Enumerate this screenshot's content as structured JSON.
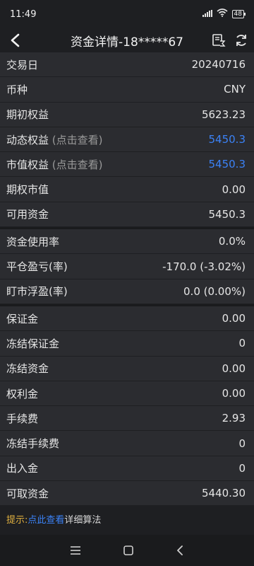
{
  "status": {
    "time": "11:49",
    "battery": "48"
  },
  "header": {
    "title": "资金详情-18*****67"
  },
  "section1": [
    {
      "label": "交易日",
      "hint": "",
      "value": "20240716",
      "link": false
    },
    {
      "label": "币种",
      "hint": "",
      "value": "CNY",
      "link": false
    },
    {
      "label": "期初权益",
      "hint": "",
      "value": "5623.23",
      "link": false
    },
    {
      "label": "动态权益",
      "hint": "(点击查看)",
      "value": "5450.3",
      "link": true
    },
    {
      "label": "市值权益",
      "hint": "(点击查看)",
      "value": "5450.3",
      "link": true
    },
    {
      "label": "期权市值",
      "hint": "",
      "value": "0.00",
      "link": false
    },
    {
      "label": "可用资金",
      "hint": "",
      "value": "5450.3",
      "link": false
    }
  ],
  "section2": [
    {
      "label": "资金使用率",
      "value": "0.0%"
    },
    {
      "label": "平仓盈亏(率)",
      "value": "-170.0 (-3.02%)"
    },
    {
      "label": "盯市浮盈(率)",
      "value": "0.0 (0.00%)"
    }
  ],
  "section3": [
    {
      "label": "保证金",
      "value": "0.00"
    },
    {
      "label": "冻结保证金",
      "value": "0"
    },
    {
      "label": "冻结资金",
      "value": "0.00"
    },
    {
      "label": "权利金",
      "value": "0.00"
    },
    {
      "label": "手续费",
      "value": "2.93"
    },
    {
      "label": "冻结手续费",
      "value": "0"
    },
    {
      "label": "出入金",
      "value": "0"
    },
    {
      "label": "可取资金",
      "value": "5440.30"
    }
  ],
  "tip": {
    "label": "提示:",
    "link": "点此查看",
    "text": "详细算法"
  },
  "colors": {
    "background": "#1e1f22",
    "row": "#2b2c30",
    "link": "#3b82f6",
    "tip_label": "#e0b040"
  }
}
